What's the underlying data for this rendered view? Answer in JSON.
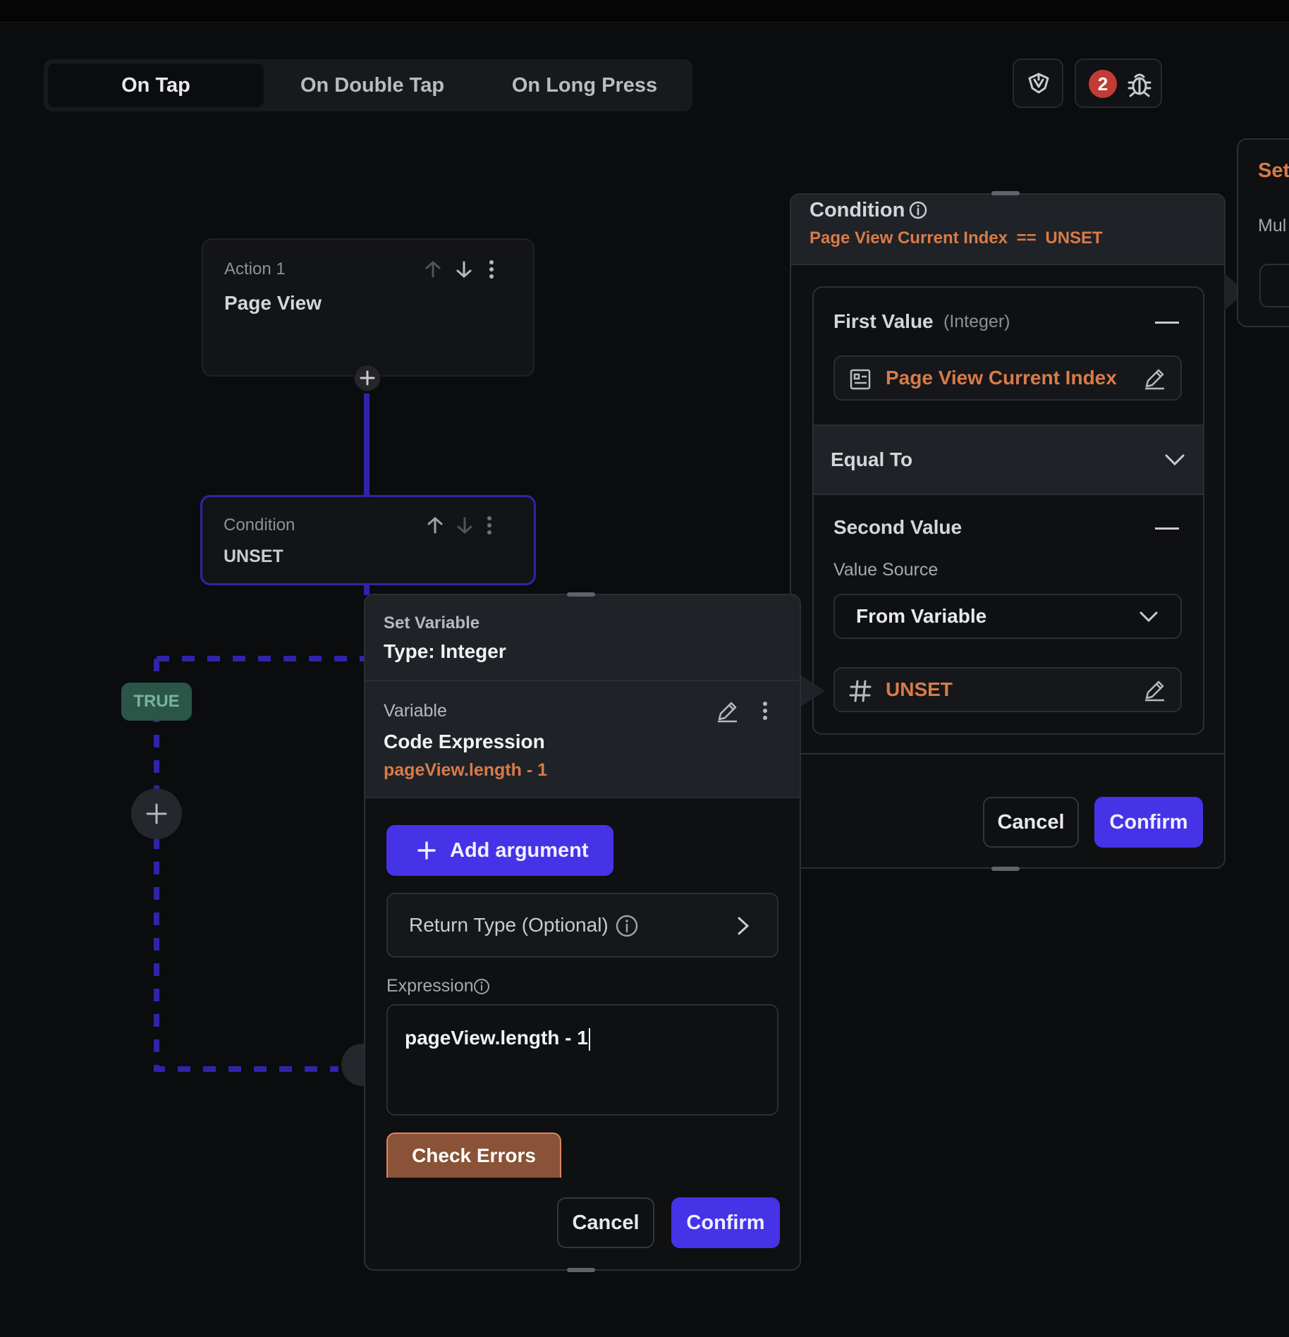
{
  "tabs": [
    {
      "label": "On Tap",
      "active": true
    },
    {
      "label": "On Double Tap",
      "active": false
    },
    {
      "label": "On Long Press",
      "active": false
    }
  ],
  "toolbar": {
    "debug_badge_count": "2",
    "icons": [
      "ai-agent-icon",
      "bug-icon"
    ]
  },
  "flow": {
    "action1": {
      "label": "Action 1",
      "title": "Page View"
    },
    "condition": {
      "label": "Condition",
      "title": "UNSET"
    },
    "true_badge": "TRUE"
  },
  "condition_panel": {
    "title": "Condition",
    "summary": {
      "left": "Page View Current Index",
      "op": "==",
      "right": "UNSET"
    },
    "first_value": {
      "label": "First Value",
      "type": "(Integer)",
      "value": "Page View Current Index"
    },
    "operator": "Equal To",
    "second_value": {
      "label": "Second Value",
      "source_label": "Value Source",
      "source": "From Variable",
      "value": "UNSET"
    },
    "cancel": "Cancel",
    "confirm": "Confirm"
  },
  "set_variable_panel": {
    "title": "Set Variable",
    "type": "Type: Integer",
    "variable_label": "Variable",
    "variable_title": "Code Expression",
    "variable_value": "pageView.length - 1",
    "add_argument": "Add argument",
    "return_type": "Return Type (Optional)",
    "expression_label": "Expression",
    "expression_value": "pageView.length - 1",
    "check_errors": "Check Errors",
    "cancel": "Cancel",
    "confirm": "Confirm"
  },
  "side_panel": {
    "title": "Set",
    "subtitle": "Mul"
  },
  "colors": {
    "accent": "#4633e8",
    "orange": "#d97b48",
    "true_green": "#2a5548",
    "badge_red": "#c23b35"
  }
}
